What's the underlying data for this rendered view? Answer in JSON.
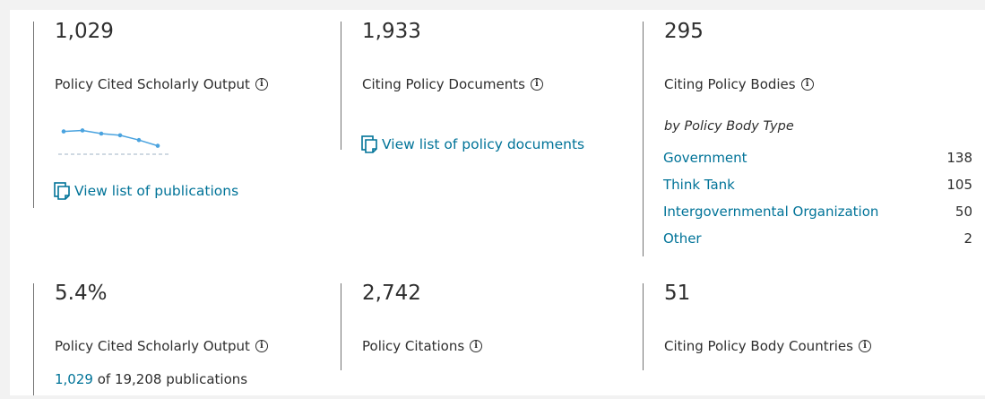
{
  "cards": {
    "scholarly_output": {
      "value": "1,029",
      "label": "Policy Cited Scholarly Output",
      "link": "View list of publications",
      "sparkline": [
        0.65,
        0.72,
        0.5,
        0.38,
        0.05,
        -0.35
      ]
    },
    "policy_documents": {
      "value": "1,933",
      "label": "Citing Policy Documents",
      "link": "View list of policy documents"
    },
    "policy_bodies": {
      "value": "295",
      "label": "Citing Policy Bodies",
      "subheading": "by Policy Body Type",
      "breakdown": [
        {
          "name": "Government",
          "count": "138"
        },
        {
          "name": "Think Tank",
          "count": "105"
        },
        {
          "name": "Intergovernmental Organization",
          "count": "50"
        },
        {
          "name": "Other",
          "count": "2"
        }
      ]
    },
    "share": {
      "value": "5.4%",
      "label": "Policy Cited Scholarly Output",
      "count_highlight": "1,029",
      "count_rest": " of 19,208 publications"
    },
    "policy_citations": {
      "value": "2,742",
      "label": "Policy Citations"
    },
    "countries": {
      "value": "51",
      "label": "Citing Policy Body Countries"
    }
  },
  "info_glyph": "i",
  "colors": {
    "link": "#007398",
    "text": "#2e2e2e",
    "divider": "#737373",
    "background": "#f2f2f2"
  }
}
